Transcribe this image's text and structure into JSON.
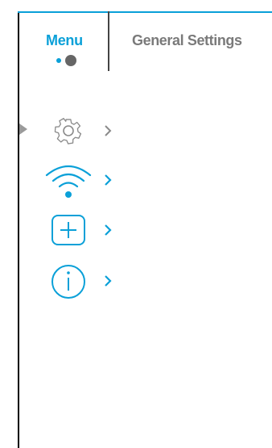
{
  "header": {
    "tabs": [
      {
        "label": "Menu",
        "active": true
      },
      {
        "label": "General Settings",
        "active": false
      }
    ],
    "page_indicator": {
      "current": 2,
      "total": 2
    }
  },
  "menu": {
    "selected_index": 0,
    "items": [
      {
        "icon": "gear-icon"
      },
      {
        "icon": "wifi-icon"
      },
      {
        "icon": "plus-square-icon"
      },
      {
        "icon": "info-icon"
      }
    ]
  },
  "colors": {
    "accent": "#0aa0d8",
    "inactive": "#7a7a7a",
    "icon_gray": "#8a8a8a"
  }
}
